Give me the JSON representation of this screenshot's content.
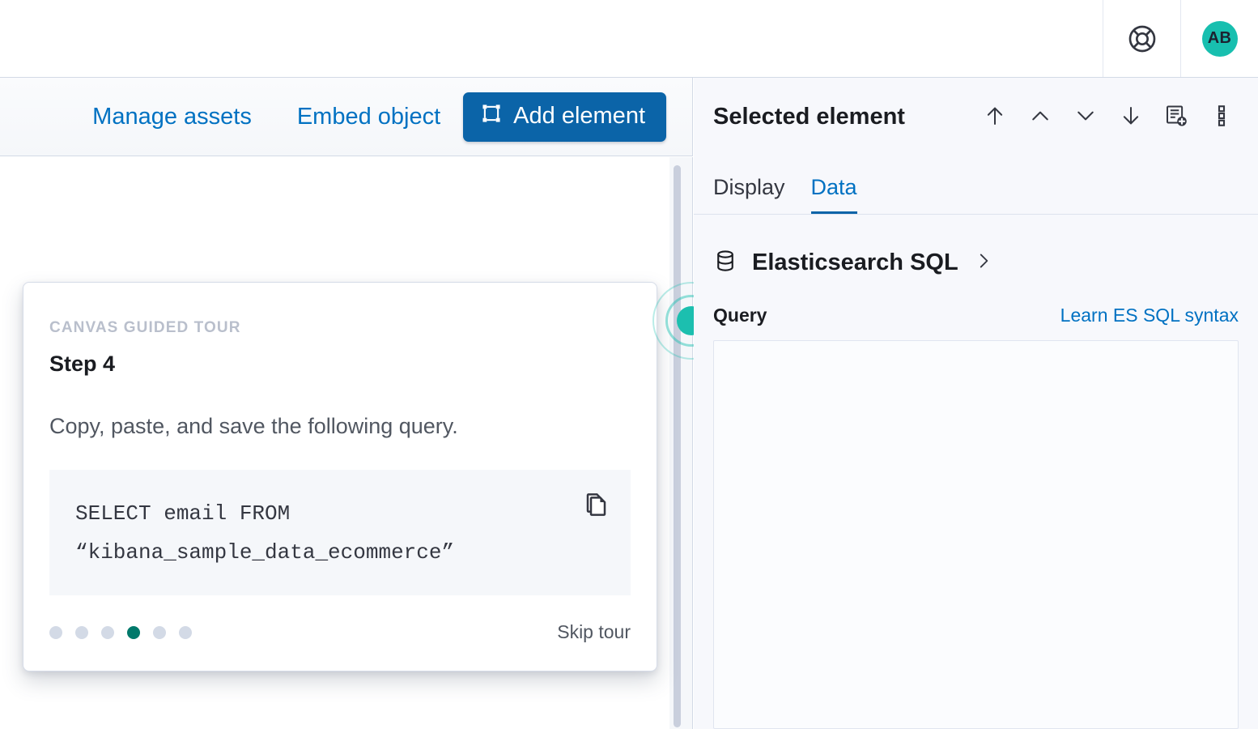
{
  "header": {
    "help_icon": "lifebuoy-icon",
    "avatar_initials": "AB",
    "avatar_color": "#18BFAF"
  },
  "toolbar": {
    "manage_assets_label": "Manage assets",
    "embed_object_label": "Embed object",
    "add_element_label": "Add element",
    "add_element_icon": "bounding-box-icon",
    "primary_color": "#0B64A8",
    "link_color": "#0071C2"
  },
  "tour": {
    "eyebrow": "CANVAS GUIDED TOUR",
    "title": "Step 4",
    "body": "Copy, paste, and save the following query.",
    "code": "SELECT email FROM\n“kibana_sample_data_ecommerce”",
    "copy_icon": "copy-icon",
    "skip_label": "Skip tour",
    "dots_total": 6,
    "dots_active_index": 3,
    "active_dot_color": "#00796B",
    "inactive_dot_color": "#D3DAE6"
  },
  "beacon": {
    "name": "pulse-beacon",
    "color": "#1CBFAF"
  },
  "panel": {
    "title": "Selected element",
    "actions": [
      {
        "name": "move-to-front-icon",
        "glyph": "arrow-up"
      },
      {
        "name": "move-up-icon",
        "glyph": "chevron-up"
      },
      {
        "name": "move-down-icon",
        "glyph": "chevron-down"
      },
      {
        "name": "move-to-back-icon",
        "glyph": "arrow-down"
      },
      {
        "name": "save-as-new-element-icon",
        "glyph": "document-plus"
      },
      {
        "name": "more-options-icon",
        "glyph": "vertical-dots"
      }
    ],
    "tabs": [
      {
        "label": "Display",
        "active": false
      },
      {
        "label": "Data",
        "active": true
      }
    ],
    "datasource": {
      "icon": "database-icon",
      "name": "Elasticsearch SQL",
      "chevron": "chevron-right-icon"
    },
    "query": {
      "label": "Query",
      "link_label": "Learn ES SQL syntax",
      "value": "",
      "placeholder": ""
    }
  }
}
